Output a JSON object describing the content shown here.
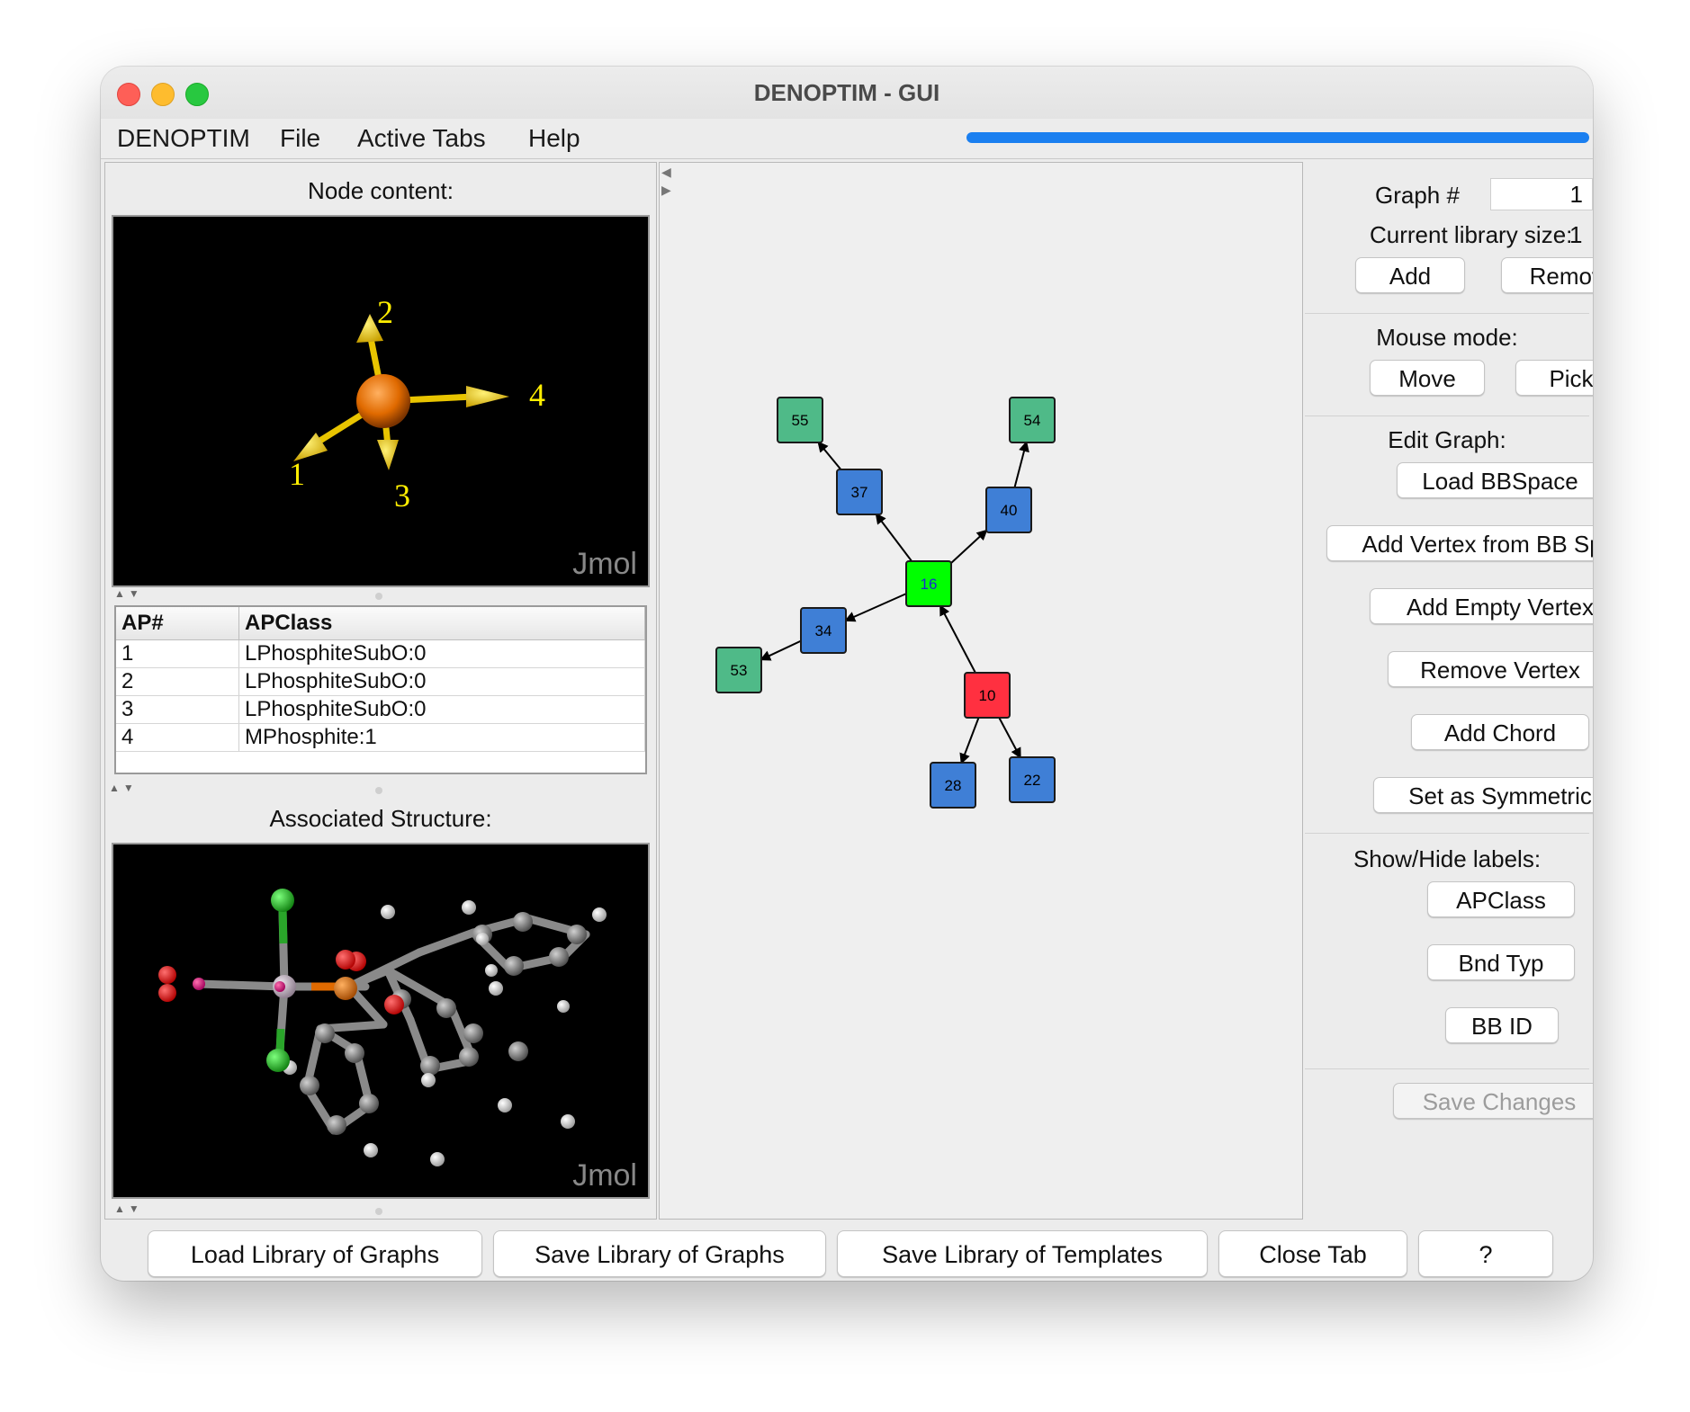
{
  "window": {
    "title": "DENOPTIM - GUI"
  },
  "menu": {
    "items": [
      "DENOPTIM",
      "File",
      "Active Tabs",
      "Help"
    ]
  },
  "left": {
    "node_content_label": "Node content:",
    "associated_structure_label": "Associated Structure:",
    "viewer_label": "Jmol",
    "ap_labels": [
      "1",
      "2",
      "3",
      "4"
    ],
    "table": {
      "headers": [
        "AP#",
        "APClass"
      ],
      "rows": [
        [
          "1",
          "LPhosphiteSubO:0"
        ],
        [
          "2",
          "LPhosphiteSubO:0"
        ],
        [
          "3",
          "LPhosphiteSubO:0"
        ],
        [
          "4",
          "MPhosphite:1"
        ]
      ]
    }
  },
  "graph": {
    "nodes": [
      {
        "id": "16",
        "color": "#00ff00"
      },
      {
        "id": "10",
        "color": "#ff3040"
      },
      {
        "id": "37",
        "color": "#3f7fd6"
      },
      {
        "id": "40",
        "color": "#3f7fd6"
      },
      {
        "id": "34",
        "color": "#3f7fd6"
      },
      {
        "id": "28",
        "color": "#3f7fd6"
      },
      {
        "id": "22",
        "color": "#3f7fd6"
      },
      {
        "id": "55",
        "color": "#4fba88"
      },
      {
        "id": "54",
        "color": "#4fba88"
      },
      {
        "id": "53",
        "color": "#4fba88"
      }
    ],
    "edges": [
      [
        "16",
        "37"
      ],
      [
        "16",
        "40"
      ],
      [
        "16",
        "34"
      ],
      [
        "37",
        "55"
      ],
      [
        "40",
        "54"
      ],
      [
        "34",
        "53"
      ],
      [
        "10",
        "16"
      ],
      [
        "10",
        "28"
      ],
      [
        "10",
        "22"
      ]
    ]
  },
  "right": {
    "graph_label": "Graph #",
    "graph_value": "1",
    "library_size_label": "Current library size:",
    "library_size_value": "1",
    "add": "Add",
    "remove": "Remove",
    "mouse_mode_label": "Mouse mode:",
    "move": "Move",
    "pick": "Pick",
    "edit_graph_label": "Edit Graph:",
    "load_bbspace": "Load BBSpace",
    "add_vertex_bb": "Add Vertex from BB Space",
    "add_empty_vertex": "Add Empty Vertex",
    "remove_vertex": "Remove Vertex",
    "add_chord": "Add Chord",
    "set_symmetric": "Set as Symmetric",
    "labels_label": "Show/Hide labels:",
    "apclass": "APClass",
    "bnd_typ": "Bnd Typ",
    "bb_id": "BB ID",
    "save_changes": "Save Changes"
  },
  "bottom": {
    "load_library": "Load Library of Graphs",
    "save_library": "Save Library of Graphs",
    "save_templates": "Save Library of Templates",
    "close_tab": "Close Tab",
    "help": "?"
  }
}
